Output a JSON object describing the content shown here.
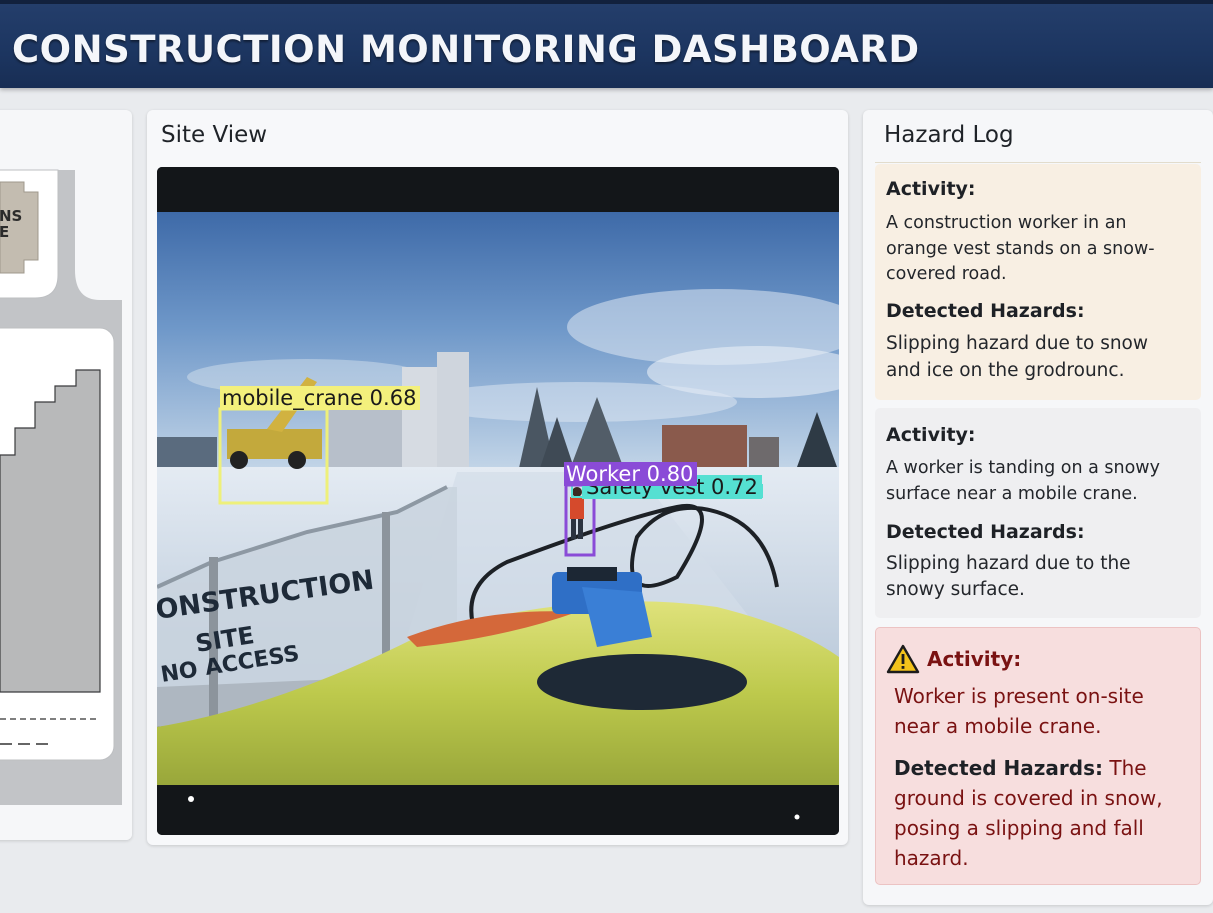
{
  "header": {
    "title": "CONSTRUCTION MONITORING DASHBOARD"
  },
  "site_map": {
    "building_label_line1": "NS",
    "building_label_line2": "E"
  },
  "site_view": {
    "title": "Site View",
    "detections": [
      {
        "label": "mobile_crane 0.68",
        "color": "#f3f07c"
      },
      {
        "label": "Worker 0.80",
        "color": "#8a4bd7"
      },
      {
        "label": "Safety vest 0.72",
        "color": "#55e0d2"
      }
    ],
    "fence_sign_line1": "ONSTRUCTION",
    "fence_sign_line2": "SITE",
    "fence_sign_line3": "NO ACCESS"
  },
  "hazard_log": {
    "title": "Hazard Log",
    "entries": [
      {
        "activity_label": "Activity:",
        "activity_text": "A construction worker in an orange vest stands on a snow-covered road.",
        "hazards_label": "Detected Hazards:",
        "hazards_text": "Slipping hazard due to snow and ice on the grodrounc."
      },
      {
        "activity_label": "Activity:",
        "activity_text": "A worker is tanding on a snowy surface near a mobile crane.",
        "hazards_label": "Detected Hazards:",
        "hazards_text": "Slipping hazard due to the snowy surface."
      },
      {
        "activity_label": "Activity:",
        "activity_text": "Worker is present on-site near a mobile crane.",
        "hazards_label": "Detected Hazards:",
        "hazards_text": "The ground is covered in snow, posing a slipping and fall hazard.",
        "alert": true,
        "icon": "warning-icon"
      }
    ]
  },
  "colors": {
    "header_bg": "#1c3560",
    "alert_bg": "#f7dede",
    "alert_text": "#7a1212",
    "card_warm_bg": "#f8efe3",
    "card_gray_bg": "#efeff1"
  }
}
